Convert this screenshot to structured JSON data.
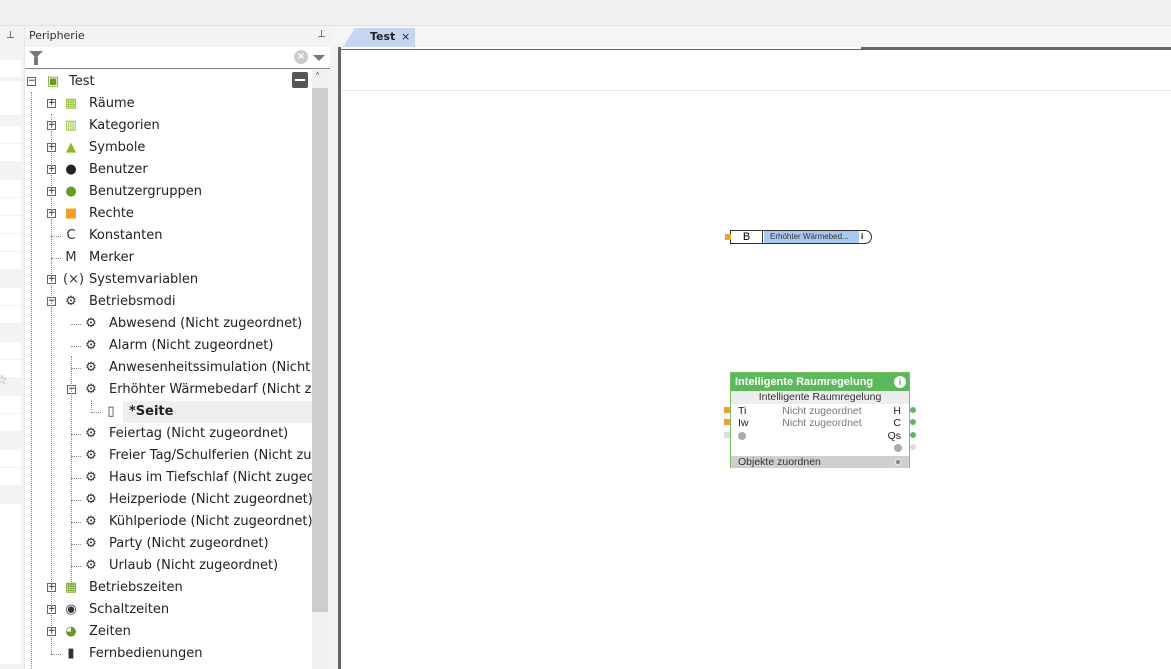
{
  "panel": {
    "title": "Peripherie",
    "filter_placeholder": ""
  },
  "tab": {
    "label": "Test",
    "close": "×"
  },
  "tree": [
    {
      "label": "Test",
      "level": 0,
      "exp": "minus",
      "icon": "project-icon"
    },
    {
      "label": "Räume",
      "level": 1,
      "exp": "plus",
      "icon": "rooms-icon"
    },
    {
      "label": "Kategorien",
      "level": 1,
      "exp": "plus",
      "icon": "categories-icon"
    },
    {
      "label": "Symbole",
      "level": 1,
      "exp": "plus",
      "icon": "symbols-icon"
    },
    {
      "label": "Benutzer",
      "level": 1,
      "exp": "plus",
      "icon": "user-icon"
    },
    {
      "label": "Benutzergruppen",
      "level": 1,
      "exp": "plus",
      "icon": "user-group-icon"
    },
    {
      "label": "Rechte",
      "level": 1,
      "exp": "plus",
      "icon": "lock-icon"
    },
    {
      "label": "Konstanten",
      "level": 1,
      "exp": "",
      "icon": "constant-icon",
      "glyph": "C"
    },
    {
      "label": "Merker",
      "level": 1,
      "exp": "",
      "icon": "marker-icon",
      "glyph": "M"
    },
    {
      "label": "Systemvariablen",
      "level": 1,
      "exp": "plus",
      "icon": "variable-icon",
      "glyph": "(×)"
    },
    {
      "label": "Betriebsmodi",
      "level": 1,
      "exp": "minus",
      "icon": "gear-icon"
    },
    {
      "label": "Abwesend (Nicht zugeordnet)",
      "level": 2,
      "exp": "",
      "icon": "mode-gear-icon"
    },
    {
      "label": "Alarm (Nicht zugeordnet)",
      "level": 2,
      "exp": "",
      "icon": "mode-gear-icon"
    },
    {
      "label": "Anwesenheitssimulation (Nicht zugeordnet)",
      "level": 2,
      "exp": "",
      "icon": "mode-gear-icon"
    },
    {
      "label": "Erhöhter Wärmebedarf (Nicht zugeordnet)",
      "level": 2,
      "exp": "minus",
      "icon": "mode-gear-icon"
    },
    {
      "label": "*Seite",
      "level": 3,
      "exp": "",
      "icon": "page-icon",
      "selected": true
    },
    {
      "label": "Feiertag (Nicht zugeordnet)",
      "level": 2,
      "exp": "",
      "icon": "mode-gear-icon"
    },
    {
      "label": "Freier Tag/Schulferien (Nicht zugeordnet)",
      "level": 2,
      "exp": "",
      "icon": "mode-gear-icon"
    },
    {
      "label": "Haus im Tiefschlaf (Nicht zugeordnet)",
      "level": 2,
      "exp": "",
      "icon": "mode-gear-icon"
    },
    {
      "label": "Heizperiode (Nicht zugeordnet)",
      "level": 2,
      "exp": "",
      "icon": "mode-gear-icon"
    },
    {
      "label": "Kühlperiode (Nicht zugeordnet)",
      "level": 2,
      "exp": "",
      "icon": "mode-gear-icon"
    },
    {
      "label": "Party (Nicht zugeordnet)",
      "level": 2,
      "exp": "",
      "icon": "mode-gear-icon"
    },
    {
      "label": "Urlaub (Nicht zugeordnet)",
      "level": 2,
      "exp": "",
      "icon": "mode-gear-icon"
    },
    {
      "label": "Betriebszeiten",
      "level": 1,
      "exp": "plus",
      "icon": "calendar-icon"
    },
    {
      "label": "Schaltzeiten",
      "level": 1,
      "exp": "plus",
      "icon": "clock-icon"
    },
    {
      "label": "Zeiten",
      "level": 1,
      "exp": "plus",
      "icon": "time-icon"
    },
    {
      "label": "Fernbedienungen",
      "level": 1,
      "exp": "",
      "icon": "remote-icon"
    }
  ],
  "block1": {
    "input": "B",
    "name": "Erhöhter Wärmebed...",
    "info": "i"
  },
  "block2": {
    "title": "Intelligente Raumregelung",
    "subtitle": "Intelligente Raumregelung",
    "info": "i",
    "rows": [
      {
        "in": "Ti",
        "mid": "Nicht zugeordnet",
        "out": "H"
      },
      {
        "in": "Iw",
        "mid": "Nicht zugeordnet",
        "out": "C"
      },
      {
        "in": "",
        "mid": "",
        "out": "Qs"
      }
    ],
    "footer": "Objekte zuordnen"
  },
  "colors": {
    "accent": "#5cb85c",
    "tab": "#c6d6f1",
    "input_port": "#f0a030",
    "output_port": "#5cb85c"
  }
}
